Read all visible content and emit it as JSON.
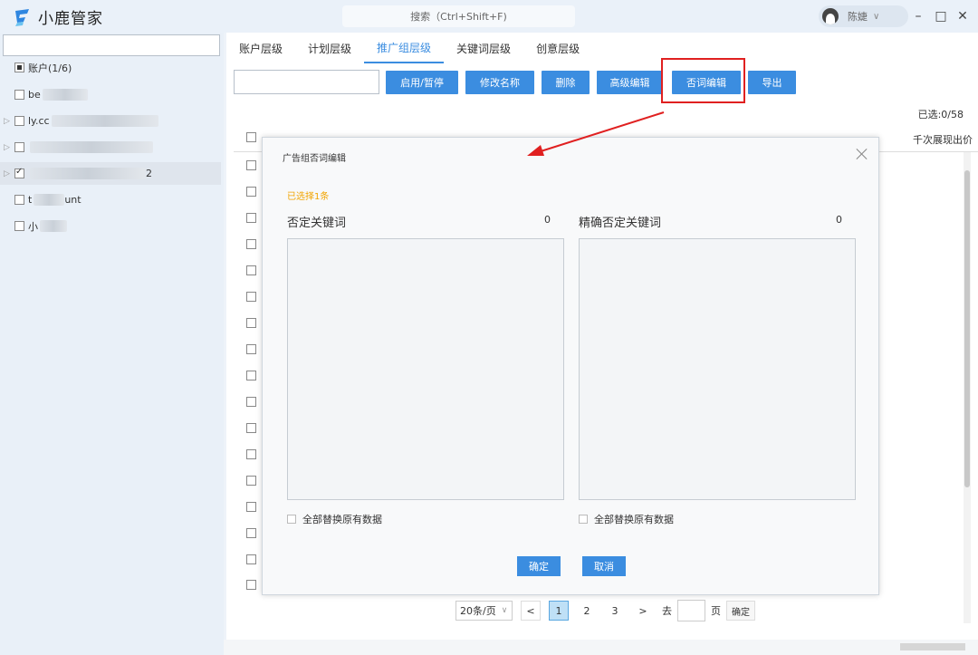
{
  "app": {
    "title": "小鹿管家"
  },
  "search": {
    "placeholder": "搜索（Ctrl+Shift+F)"
  },
  "user": {
    "name": "陈婕"
  },
  "sidebar": {
    "root_label": "账户(1/6)",
    "items": [
      {
        "label": "be"
      },
      {
        "label": "ly.cc"
      },
      {
        "label": ""
      },
      {
        "label": "2"
      },
      {
        "label": "t",
        "suffix": "unt"
      },
      {
        "label": "小"
      }
    ]
  },
  "tabs": [
    {
      "label": "账户层级",
      "active": false
    },
    {
      "label": "计划层级",
      "active": false
    },
    {
      "label": "推广组层级",
      "active": true
    },
    {
      "label": "关键词层级",
      "active": false
    },
    {
      "label": "创意层级",
      "active": false
    }
  ],
  "toolbar": {
    "enable_pause": "启用/暂停",
    "rename": "修改名称",
    "delete": "删除",
    "advanced_edit": "高级编辑",
    "negative_edit": "否词编辑",
    "export": "导出"
  },
  "table": {
    "selected_count": "已选:0/58",
    "right_header": "千次展现出价"
  },
  "pagination": {
    "page_size": "20条/页",
    "prev": "<",
    "pages": [
      "1",
      "2",
      "3"
    ],
    "next": ">",
    "goto_label": "去",
    "page_unit": "页",
    "confirm": "确定"
  },
  "dialog": {
    "title": "广告组否词编辑",
    "selected_info": "已选择1条",
    "left_panel": {
      "label": "否定关键词",
      "count": "0",
      "replace": "全部替换原有数据"
    },
    "right_panel": {
      "label": "精确否定关键词",
      "count": "0",
      "replace": "全部替换原有数据"
    },
    "confirm": "确定",
    "cancel": "取消"
  },
  "colors": {
    "accent": "#3b8de0",
    "highlight": "#e02020",
    "warning": "#f2a400"
  }
}
